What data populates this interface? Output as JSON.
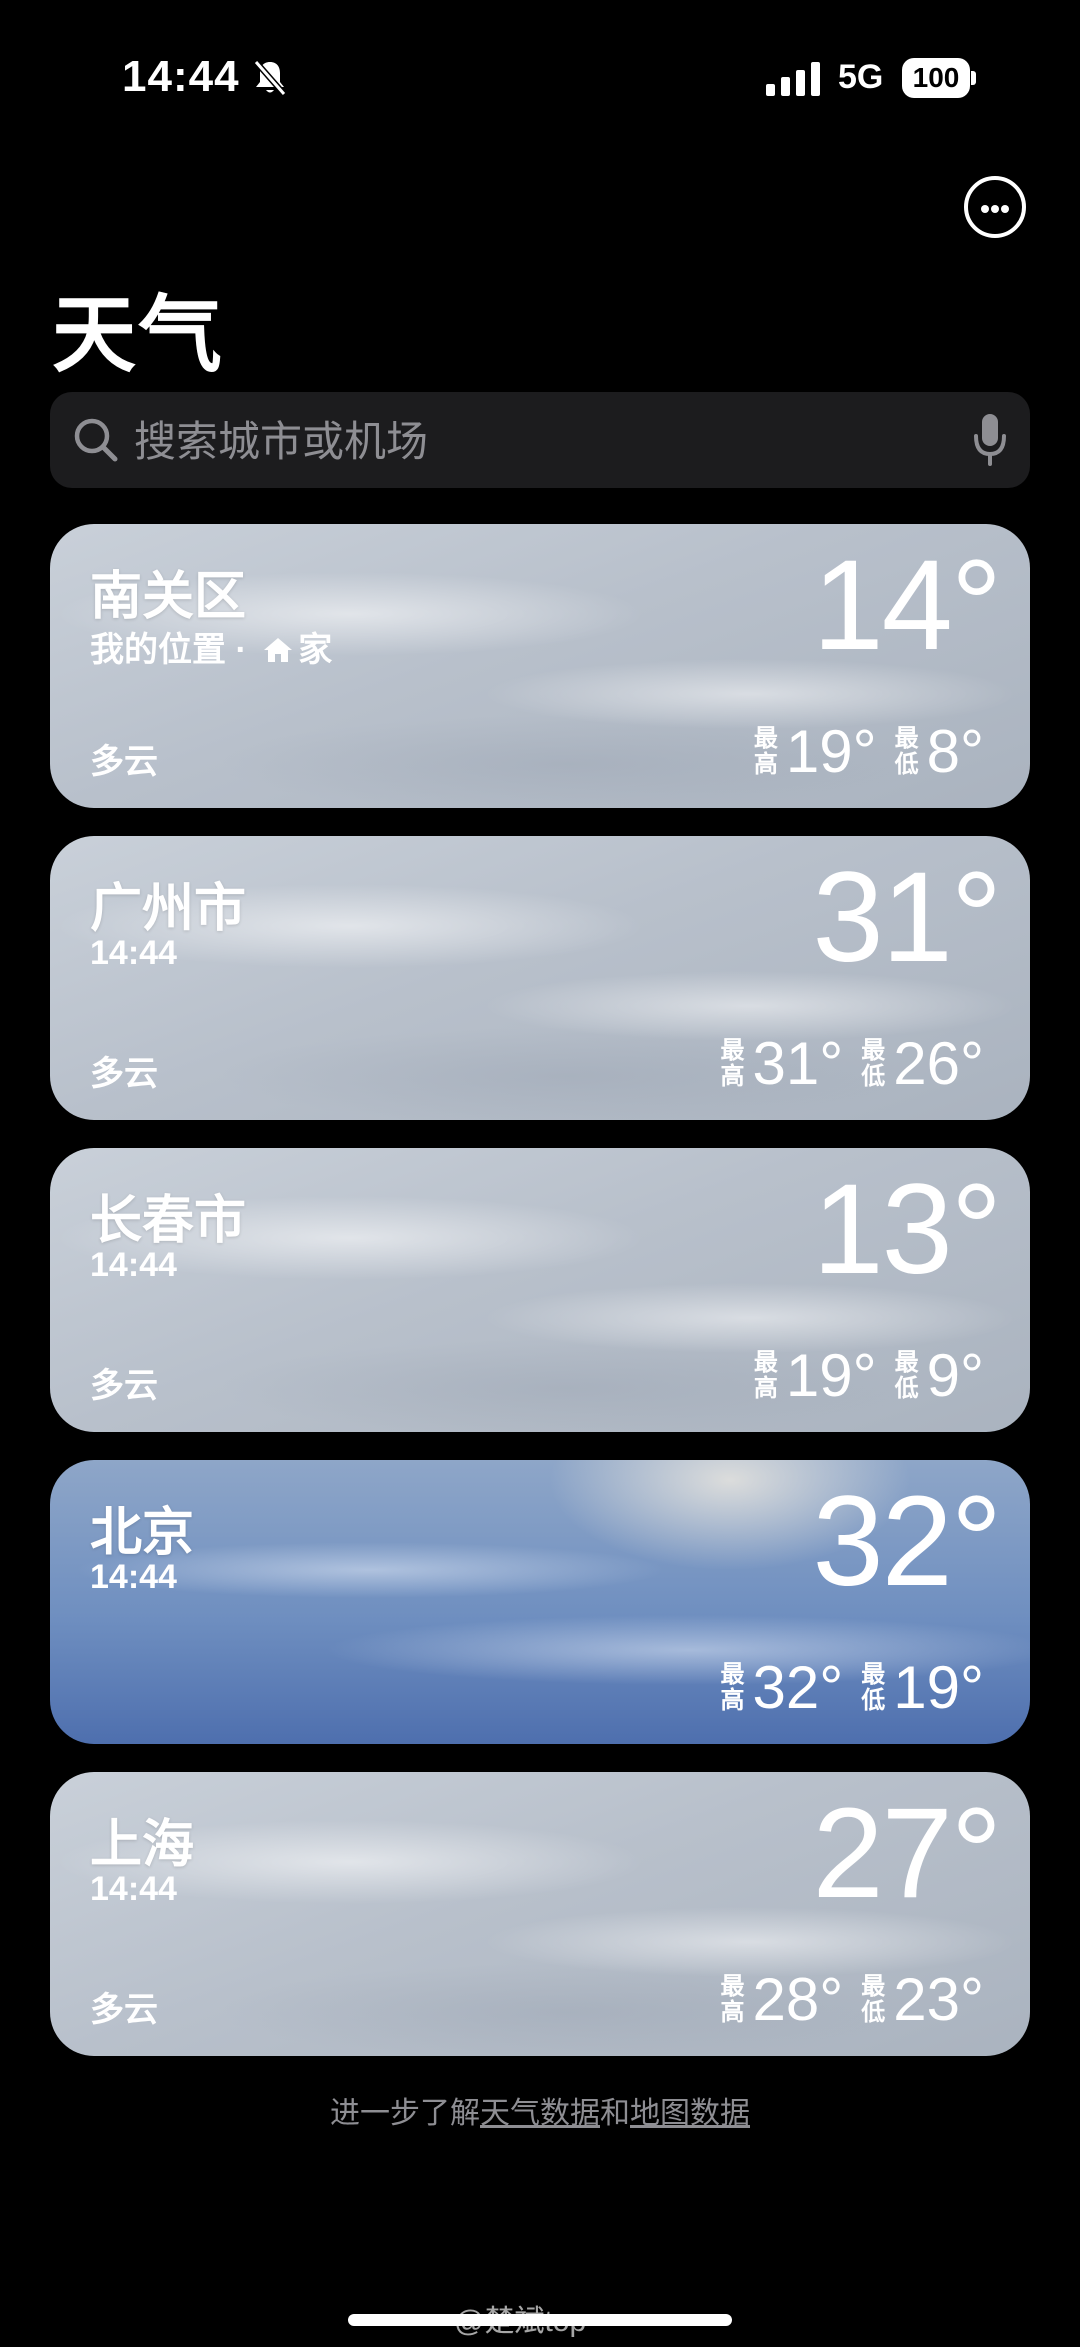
{
  "status_bar": {
    "time": "14:44",
    "network": "5G",
    "battery": "100"
  },
  "header": {
    "title": "天气",
    "more_icon": "ellipsis-circle-icon"
  },
  "search": {
    "placeholder": "搜索城市或机场",
    "icon": "search-icon",
    "mic_icon": "mic-icon"
  },
  "cards": [
    {
      "city": "南关区",
      "sub": "我的位置 · ",
      "home_label": "家",
      "temp": "14°",
      "condition": "多云",
      "high_label_1": "最",
      "high_label_2": "高",
      "high": "19°",
      "low_label_1": "最",
      "low_label_2": "低",
      "low": "8°"
    },
    {
      "city": "广州市",
      "sub": "14:44",
      "temp": "31°",
      "condition": "多云",
      "high_label_1": "最",
      "high_label_2": "高",
      "high": "31°",
      "low_label_1": "最",
      "low_label_2": "低",
      "low": "26°"
    },
    {
      "city": "长春市",
      "sub": "14:44",
      "temp": "13°",
      "condition": "多云",
      "high_label_1": "最",
      "high_label_2": "高",
      "high": "19°",
      "low_label_1": "最",
      "low_label_2": "低",
      "low": "9°"
    },
    {
      "city": "北京",
      "sub": "14:44",
      "temp": "32°",
      "condition": "",
      "high_label_1": "最",
      "high_label_2": "高",
      "high": "32°",
      "low_label_1": "最",
      "low_label_2": "低",
      "low": "19°"
    },
    {
      "city": "上海",
      "sub": "14:44",
      "temp": "27°",
      "condition": "多云",
      "high_label_1": "最",
      "high_label_2": "高",
      "high": "28°",
      "low_label_1": "最",
      "low_label_2": "低",
      "low": "23°"
    }
  ],
  "footer": {
    "prefix": "进一步了解",
    "weather_link": "天气数据",
    "joiner": "和",
    "map_link": "地图数据"
  },
  "watermark": "@楚斌top"
}
